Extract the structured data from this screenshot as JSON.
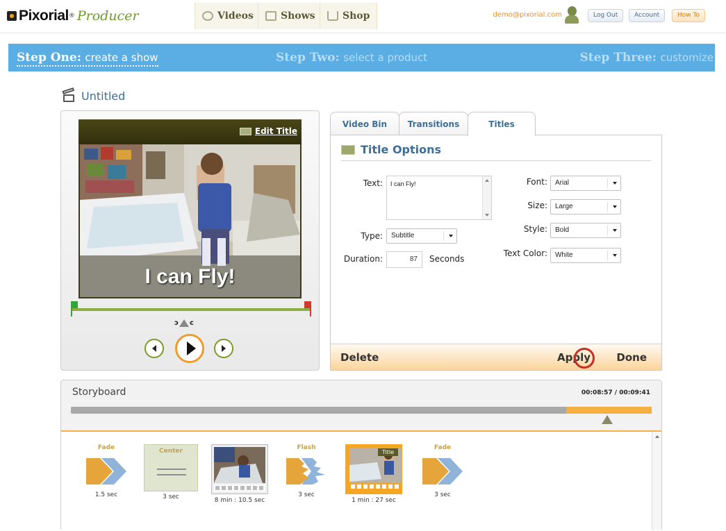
{
  "brand": {
    "name": "Pixorial",
    "reg": "®",
    "sub": "Producer"
  },
  "nav": {
    "tabs": [
      {
        "label": "Videos",
        "icon": "film-reel-icon"
      },
      {
        "label": "Shows",
        "icon": "shows-icon"
      },
      {
        "label": "Shop",
        "icon": "shop-cart-icon"
      }
    ],
    "email": "demo@pixorial.com",
    "logout": "Log Out",
    "account": "Account",
    "howto": "How To"
  },
  "steps": [
    {
      "num": "Step One:",
      "label": "create a show"
    },
    {
      "num": "Step Two:",
      "label": "select a product"
    },
    {
      "num": "Step Three:",
      "label": "customize"
    }
  ],
  "show": {
    "title": "Untitled"
  },
  "preview": {
    "edit_title": "Edit Title",
    "caption": "I can Fly!"
  },
  "panel": {
    "tabs": [
      "Video Bin",
      "Transitions",
      "Titles"
    ],
    "heading": "Title Options",
    "text_label": "Text:",
    "text_value": "I can Fly!",
    "type_label": "Type:",
    "type_value": "Subtitle",
    "duration_label": "Duration:",
    "duration_value": "87",
    "duration_unit": "Seconds",
    "font_label": "Font:",
    "font_value": "Arial",
    "size_label": "Size:",
    "size_value": "Large",
    "style_label": "Style:",
    "style_value": "Bold",
    "color_label": "Text Color:",
    "color_value": "White",
    "delete": "Delete",
    "apply": "Apply",
    "done": "Done"
  },
  "storyboard": {
    "title": "Storyboard",
    "time": "00:08:57 / 00:09:41",
    "progress": 0.853,
    "items": [
      {
        "kind": "transition",
        "label": "Fade",
        "caption": "1.5 sec"
      },
      {
        "kind": "title",
        "label": "Center",
        "caption": "3 sec"
      },
      {
        "kind": "clip",
        "caption": "8 min : 10.5 sec"
      },
      {
        "kind": "transition",
        "label": "Flash",
        "caption": "3 sec"
      },
      {
        "kind": "clip",
        "badge": "Title",
        "caption": "1 min : 27 sec"
      },
      {
        "kind": "transition",
        "label": "Fade",
        "caption": "3 sec"
      }
    ]
  },
  "colors": {
    "steps_bg": "#5aaee3",
    "accent_orange": "#f5a623",
    "link_blue": "#3f6e97",
    "green": "#7b9a2a"
  }
}
